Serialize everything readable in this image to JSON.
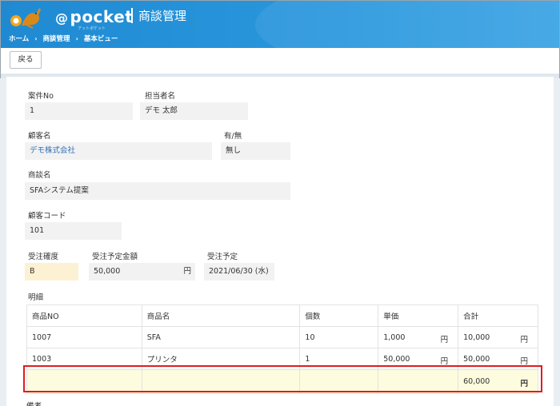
{
  "header": {
    "logo_text": "pocket",
    "logo_at": "@",
    "logo_sub": "アットポケット",
    "page_title": "商談管理",
    "breadcrumb": [
      "ホーム",
      "商談管理",
      "基本ビュー"
    ],
    "breadcrumb_sep": "›"
  },
  "toolbar": {
    "back_label": "戻る"
  },
  "fields": {
    "case_no": {
      "label": "案件No",
      "value": "1"
    },
    "owner": {
      "label": "担当者名",
      "value": "デモ 太郎"
    },
    "customer": {
      "label": "顧客名",
      "value": "デモ株式会社"
    },
    "presence": {
      "label": "有/無",
      "value": "無し"
    },
    "deal_name": {
      "label": "商談名",
      "value": "SFAシステム提案"
    },
    "customer_code": {
      "label": "顧客コード",
      "value": "101"
    },
    "order_certainty": {
      "label": "受注確度",
      "value": "B"
    },
    "order_amount": {
      "label": "受注予定金額",
      "value": "50,000",
      "unit": "円"
    },
    "order_date": {
      "label": "受注予定",
      "value": "2021/06/30 (水)"
    }
  },
  "details": {
    "label": "明細",
    "columns": [
      "商品NO",
      "商品名",
      "個数",
      "単価",
      "合計"
    ],
    "rows": [
      {
        "no": "1007",
        "name": "SFA",
        "qty": "10",
        "price": "1,000",
        "total": "10,000"
      },
      {
        "no": "1003",
        "name": "プリンタ",
        "qty": "1",
        "price": "50,000",
        "total": "50,000"
      }
    ],
    "grand_total": "60,000",
    "unit": "円"
  },
  "remarks_label": "備考",
  "colors": {
    "header": "#1f8ad2",
    "highlight": "#e01c1c",
    "link": "#2a6fb8"
  }
}
